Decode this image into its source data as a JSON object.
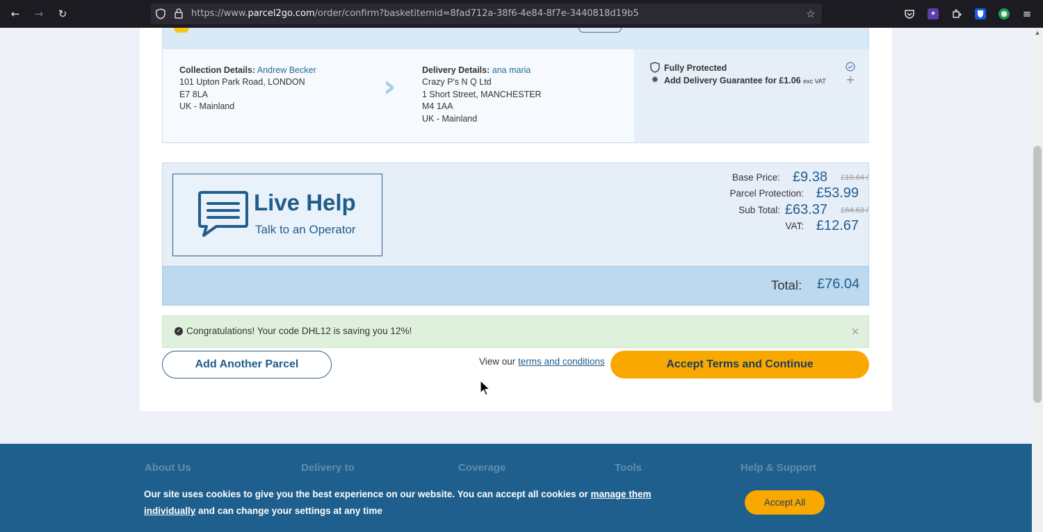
{
  "browser": {
    "url_prefix": "https://www.",
    "url_host": "parcel2go.com",
    "url_path": "/order/confirm?basketitemid=8fad712a-38f6-4e84-8f7e-3440818d19b5",
    "icons": [
      "back-arrow",
      "forward-arrow",
      "reload",
      "tracking-shield",
      "lock",
      "star",
      "pocket",
      "extension",
      "puzzle",
      "bitwarden",
      "account",
      "menu"
    ]
  },
  "collection": {
    "label": "Collection Details:",
    "name": "Andrew Becker",
    "lines": [
      "101 Upton Park Road, LONDON",
      "E7 8LA",
      "UK - Mainland"
    ]
  },
  "delivery": {
    "label": "Delivery Details:",
    "name": "ana maria",
    "lines": [
      "Crazy P's N Q Ltd",
      "1 Short Street, MANCHESTER",
      "M4 1AA",
      "UK - Mainland"
    ]
  },
  "protection": {
    "fully_protected": "Fully Protected",
    "guarantee": "Add Delivery Guarantee for £1.06",
    "guarantee_suffix": "exc VAT"
  },
  "live_help": {
    "title": "Live Help",
    "subtitle": "Talk to an Operator"
  },
  "prices": {
    "base_label": "Base Price:",
    "base_value": "£9.38",
    "base_old": "£10.64",
    "protection_label": "Parcel Protection:",
    "protection_value": "£53.99",
    "subtotal_label": "Sub Total:",
    "subtotal_value": "£63.37",
    "subtotal_old": "£64.63",
    "vat_label": "VAT:",
    "vat_value": "£12.67",
    "total_label": "Total:",
    "total_value": "£76.04"
  },
  "promo": {
    "text": "Congratulations! Your code DHL12 is saving you 12%!"
  },
  "actions": {
    "add_parcel": "Add Another Parcel",
    "terms_prefix": "View our",
    "terms_link": "terms and conditions",
    "accept": "Accept Terms and Continue"
  },
  "footer": {
    "headings": [
      "About Us",
      "Delivery to",
      "Coverage",
      "Tools",
      "Help & Support"
    ]
  },
  "cookie": {
    "text_before": "Our site uses cookies to give you the best experience on our website. You can accept all cookies or",
    "link": "manage them individually",
    "text_after": "and can change your settings at any time",
    "button": "Accept All"
  },
  "colors": {
    "brand_blue": "#1f5d8c",
    "accent_orange": "#f9a800",
    "success_green": "#dff1dc"
  }
}
